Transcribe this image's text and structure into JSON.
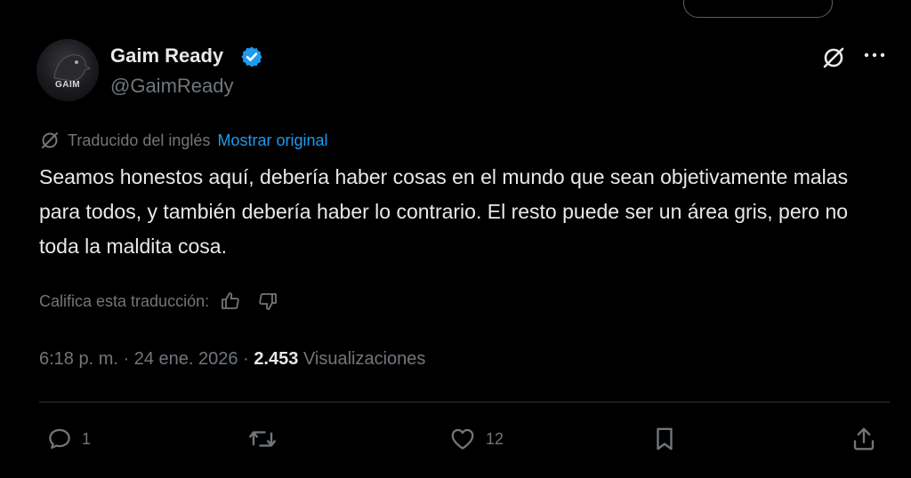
{
  "author": {
    "display_name": "Gaim Ready",
    "handle": "@GaimReady",
    "avatar_text": "GAIM"
  },
  "translation": {
    "label": "Traducido del inglés",
    "show_original": "Mostrar original"
  },
  "tweet": {
    "text": "Seamos honestos aquí, debería haber cosas en el mundo que sean objetivamente malas para todos, y también debería haber lo contrario. El resto puede ser un área gris, pero no toda la maldita cosa."
  },
  "rating": {
    "prompt": "Califica esta traducción:"
  },
  "meta": {
    "time": "6:18 p. m.",
    "separator": "·",
    "date": "24 ene. 2026",
    "views_count": "2.453",
    "views_label": "Visualizaciones"
  },
  "actions": {
    "replies": "1",
    "likes": "12"
  },
  "colors": {
    "background": "#000000",
    "text": "#e7e9ea",
    "muted": "#71767b",
    "link": "#1d9bf0",
    "verified": "#1d9bf0"
  },
  "icons": [
    "verified-badge-icon",
    "grok-icon",
    "more-icon",
    "translate-icon",
    "thumbs-up-icon",
    "thumbs-down-icon",
    "reply-icon",
    "retweet-icon",
    "like-icon",
    "bookmark-icon",
    "share-icon"
  ]
}
